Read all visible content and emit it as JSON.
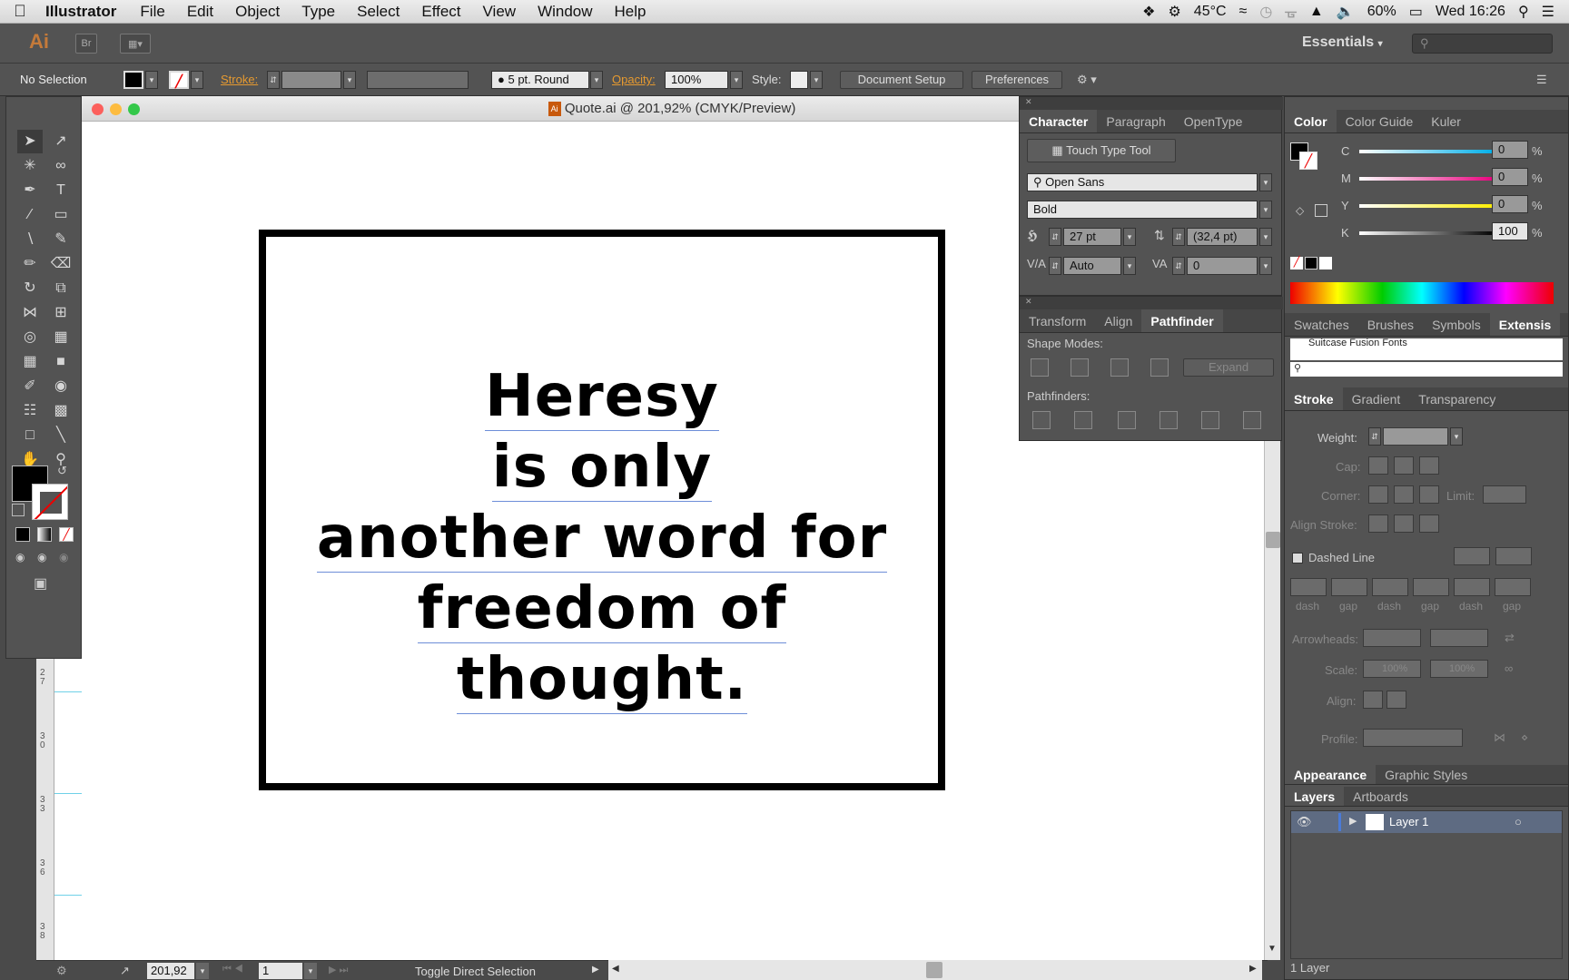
{
  "menubar": {
    "app": "Illustrator",
    "items": [
      "File",
      "Edit",
      "Object",
      "Type",
      "Select",
      "Effect",
      "View",
      "Window",
      "Help"
    ],
    "status": {
      "temp": "45°C",
      "battery": "60%",
      "clock": "Wed 16:26"
    }
  },
  "appbar": {
    "logo": "Ai",
    "bridge": "Br",
    "workspace": "Essentials"
  },
  "control": {
    "selection": "No Selection",
    "stroke_label": "Stroke:",
    "brush": "5 pt. Round",
    "opacity_label": "Opacity:",
    "opacity": "100%",
    "style_label": "Style:",
    "document_setup": "Document Setup",
    "preferences": "Preferences"
  },
  "document": {
    "title": "Quote.ai @ 201,92% (CMYK/Preview)",
    "quote_lines": [
      "Heresy",
      "is only",
      "another word for",
      "freedom of thought."
    ],
    "ruler_marks": [
      "2",
      "7",
      "3",
      "0",
      "3",
      "3",
      "3",
      "6",
      "3",
      "8"
    ],
    "zoom": "201,92",
    "artboard_nav": "1",
    "status_text": "Toggle Direct Selection"
  },
  "character_panel": {
    "tabs": [
      "Character",
      "Paragraph",
      "OpenType"
    ],
    "touch_type": "Touch Type Tool",
    "font_family": "Open Sans",
    "font_style": "Bold",
    "size": "27 pt",
    "leading": "(32,4 pt)",
    "kerning": "Auto",
    "tracking": "0"
  },
  "pathfinder_panel": {
    "tabs": [
      "Transform",
      "Align",
      "Pathfinder"
    ],
    "shape_modes": "Shape Modes:",
    "expand": "Expand",
    "pathfinders": "Pathfinders:"
  },
  "color_panel": {
    "tabs": [
      "Color",
      "Color Guide",
      "Kuler"
    ],
    "channels": [
      {
        "label": "C",
        "value": "0",
        "color": "#00aee8"
      },
      {
        "label": "M",
        "value": "0",
        "color": "#e8007d"
      },
      {
        "label": "Y",
        "value": "0",
        "color": "#ffee00"
      },
      {
        "label": "K",
        "value": "100",
        "color": "#000000"
      }
    ],
    "percent": "%"
  },
  "swatches_panel": {
    "tabs": [
      "Swatches",
      "Brushes",
      "Symbols",
      "Extensis"
    ],
    "item": "Suitcase Fusion Fonts"
  },
  "stroke_panel": {
    "tabs": [
      "Stroke",
      "Gradient",
      "Transparency"
    ],
    "weight": "Weight:",
    "cap": "Cap:",
    "corner": "Corner:",
    "limit": "Limit:",
    "align_stroke": "Align Stroke:",
    "dashed_line": "Dashed Line",
    "dash_labels": [
      "dash",
      "gap",
      "dash",
      "gap",
      "dash",
      "gap"
    ],
    "arrowheads": "Arrowheads:",
    "scale": "Scale:",
    "scale_value": "100%",
    "align": "Align:",
    "profile": "Profile:"
  },
  "appearance_panel": {
    "tabs": [
      "Appearance",
      "Graphic Styles"
    ]
  },
  "layers_panel": {
    "tabs": [
      "Layers",
      "Artboards"
    ],
    "layer_name": "Layer 1",
    "count": "1 Layer"
  }
}
